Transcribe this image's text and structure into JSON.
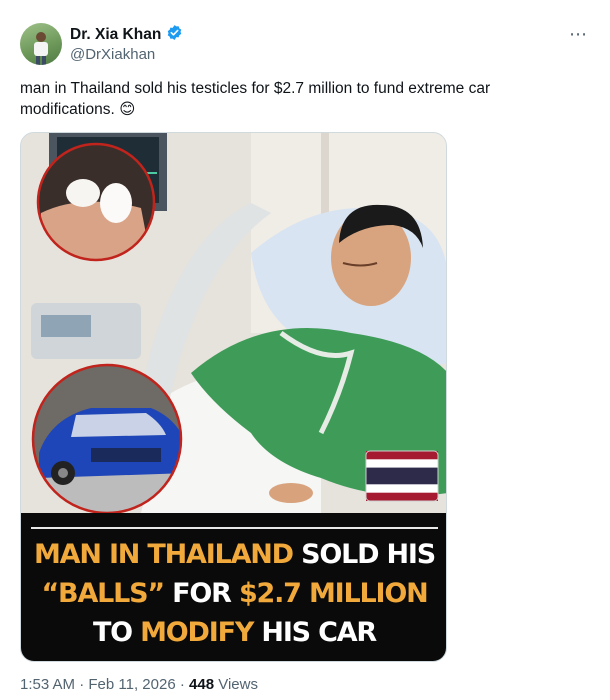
{
  "author": {
    "display_name": "Dr. Xia Khan",
    "handle": "@DrXiakhan",
    "verified": true,
    "verified_color": "#1d9bf0"
  },
  "more_icon": "more-horizontal-icon",
  "tweet": {
    "text": "man in Thailand sold his testicles for $2.7 million to fund extreme car modifications. 😊"
  },
  "media": {
    "headline": {
      "line1_highlight": "MAN IN THAILAND",
      "line1_rest": " SOLD HIS",
      "line2_highlight": "“BALLS”",
      "line2_mid": " FOR ",
      "line2_highlight2": "$2.7 MILLION",
      "line3_start": "TO ",
      "line3_highlight": "MODIFY",
      "line3_rest": " HIS CAR"
    },
    "accent_color": "#f2a93b",
    "icons": [
      "hospital-patient-photo",
      "eggs-in-hand-inset",
      "blue-sports-car-inset",
      "thailand-flag-icon"
    ]
  },
  "meta": {
    "time": "1:53 AM",
    "sep1": " · ",
    "date": "Feb 11, 2026",
    "sep2": " · ",
    "views_count": "448",
    "views_label": " Views"
  }
}
